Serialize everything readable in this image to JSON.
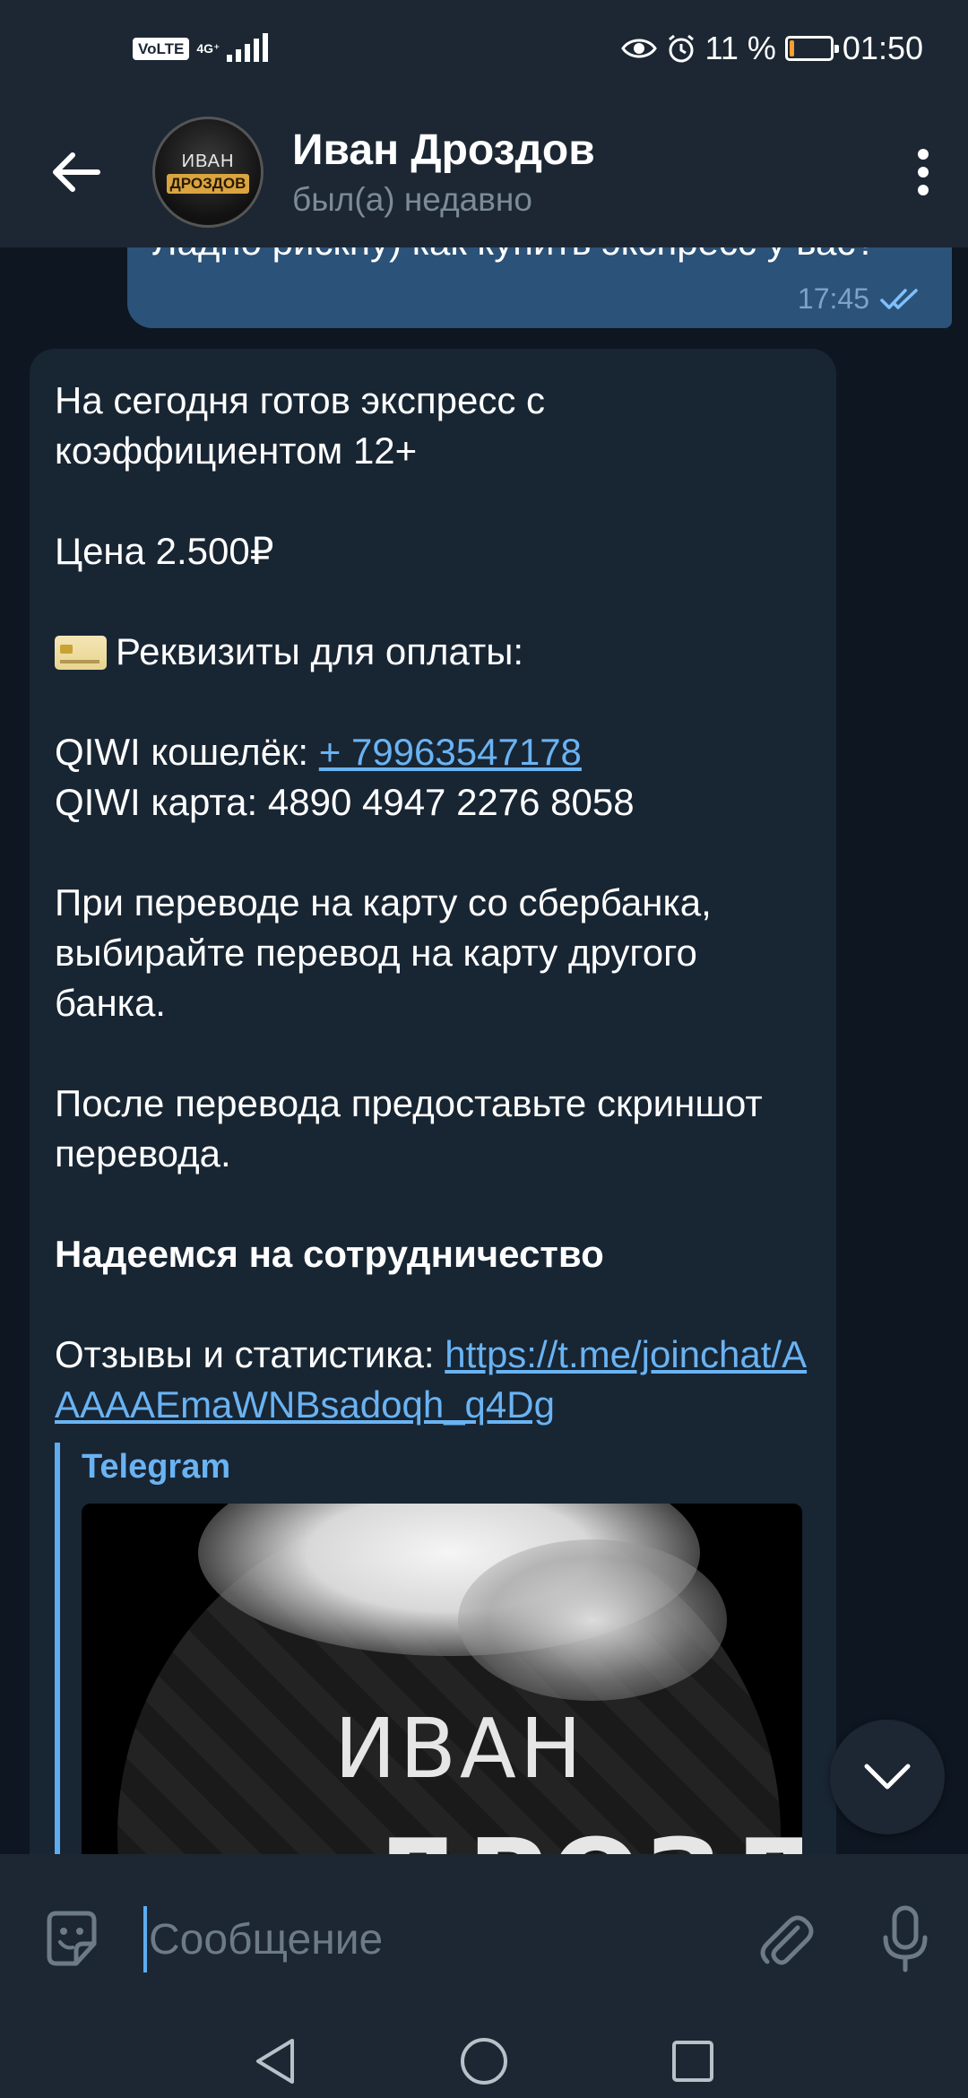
{
  "status_bar": {
    "volte": "VoLTE",
    "network": "4G⁺",
    "battery_percent": "11 %",
    "battery_level": 0.11,
    "time": "01:50"
  },
  "header": {
    "name": "Иван Дроздов",
    "status": "был(а) недавно",
    "avatar_line1": "ИВАН",
    "avatar_line2": "ДРОЗДОВ"
  },
  "messages": {
    "outgoing": {
      "text": "Ладно рискну) как купить экспресс у вас?",
      "time": "17:45"
    },
    "incoming": {
      "line1": "На сегодня готов экспресс с коэффициентом 12+",
      "price": "Цена 2.500₽",
      "requisites": "Реквизиты для оплаты:",
      "qiwi_wallet_label": "QIWI кошелёк: ",
      "qiwi_wallet_number": "+ 79963547178",
      "qiwi_card": "QIWI карта: 4890 4947 2276 8058",
      "sber_note": "При переводе на карту со сбербанка, выбирайте перевод на карту другого банка.",
      "screenshot_note": "После перевода предоставьте скриншот перевода.",
      "cooperation": "Надеемся на сотрудничество",
      "reviews_label": "Отзывы и статистика: ",
      "reviews_link": "https://t.me/joinchat/AAAAAEmaWNBsadoqh_q4Dg",
      "preview_site": "Telegram",
      "preview_word1": "ИВАН",
      "preview_word2": "ДРОЗДОВ"
    }
  },
  "input": {
    "placeholder": "Сообщение"
  },
  "colors": {
    "background": "#0e1621",
    "bars": "#1c2733",
    "outgoing_bubble": "#2b5278",
    "incoming_bubble": "#182533",
    "link": "#6ab3f3",
    "battery": "#ff9d2e"
  }
}
